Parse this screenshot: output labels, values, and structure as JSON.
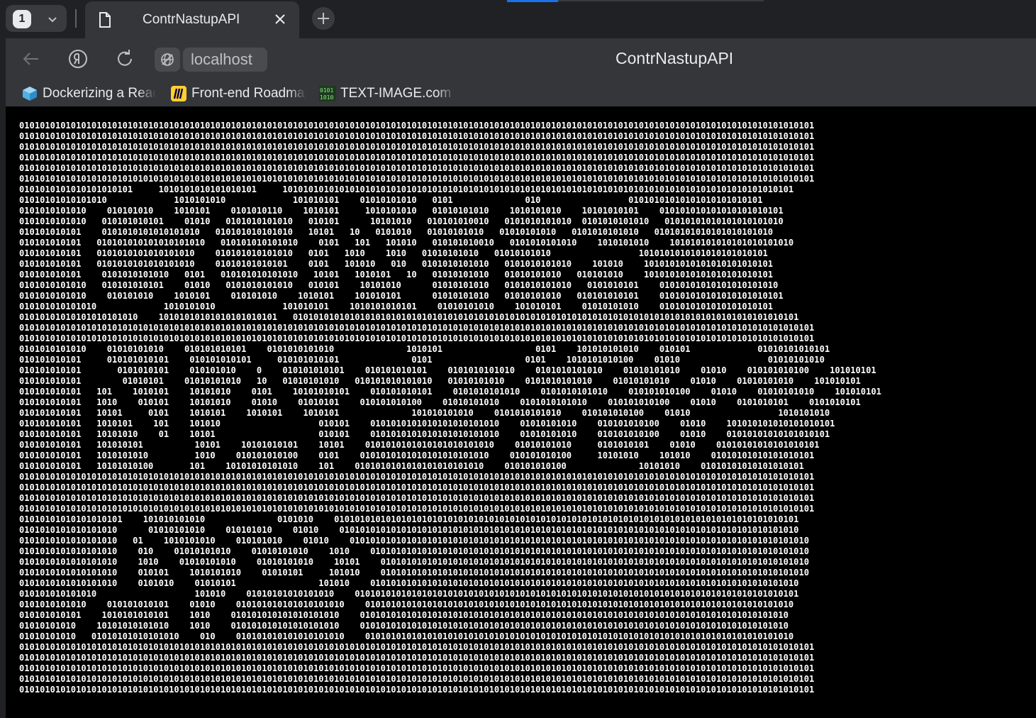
{
  "tabs": {
    "count": "1",
    "active_title": "ContrNastupAPI"
  },
  "toolbar": {
    "address": "localhost",
    "page_title": "ContrNastupAPI"
  },
  "bookmarks": [
    {
      "label": "Dockerizing a React",
      "icon": "cube-icon"
    },
    {
      "label": "Front-end Roadmap",
      "icon": "miro-logo-icon"
    },
    {
      "label": "TEXT-IMAGE.com :",
      "icon": "binary-icon"
    }
  ],
  "content": {
    "ascii_art": "0101010101010101010101010101010101010101010101010101010101010101010101010101010101010101010101010101010101010101010101010101010101010101010101010101010101\n0101010101010101010101010101010101010101010101010101010101010101010101010101010101010101010101010101010101010101010101010101010101010101010101010101010101\n0101010101010101010101010101010101010101010101010101010101010101010101010101010101010101010101010101010101010101010101010101010101010101010101010101010101\n0101010101010101010101010101010101010101010101010101010101010101010101010101010101010101010101010101010101010101010101010101010101010101010101010101010101\n0101010101010101010101010101010101010101010101010101010101010101010101010101010101010101010101010101010101010101010101010101010101010101010101010101010101\n0101010101010101010101010101010101010101010101010101010101010101010101010101010101010101010101010101010101010101010101010101010101010101010101010101010101\n0101010101010101010101     1010101010101010101     101010101010101010101010101010101010101010101010101010101010101010101010101010101010101010101010101\n01010101010101010             1010101010             101010101    01010101010   0101              010                 01010101010101010101010101\n0101010101010    010101010    1010101    0101010110    1010101     1010101010   01010101010    1010101010    10101010101    010101010101010101010101\n0101010101010   010101010101    01010   0101010101010   010101      10101010   010101010010   0101010101010  0101010101010   01010101010101010101010\n010101010101    0101010101010101010   010101010101010   10101   10   0101010   01010101010   01010101010   0101010101010   01010101010101010101010\n010101010101   010101010101010101010   010101010101010    0101   101   101010   010101010010   0101010101010    1010101010    101010101010101010101010\n010101010101   0101010101010101010    010101010101010   0101   1010    1010   01010101010   01010101010                 1010101010101010101010101\n010101010101   0101010101010101010    01010101010101    0101   101010   010   0101010101010   0101010101010    101010    1010101010101010101010101\n010101010101    0101010101010   0101   010101010101010   10101   1010101   10   01010101010   01010101010   010101010    1010101010101010101010101\n0101010101010   010101010101    01010   0101010101010   010101    10101010      01010101010   0101010101010   0101010101    01010101010101010101010\n0101010101010    010101010    1010101    010101010    1010101    101010101      01010101010   01010101010   010101010101    010101010101010101010101\n010101010101010             1010101010             101010101    1010101010101    01010101010    101010101    01010101010    0101010101010101010101\n01010101010101010101010    10101010101010101010101   01010101010101010101010101010101010101010101010101010101010101010101010101010101010101010101010101\n0101010101010101010101010101010101010101010101010101010101010101010101010101010101010101010101010101010101010101010101010101010101010101010101010101010101\n0101010101010101010101010101010101010101010101010101010101010101010101010101010101010101010101010101010101010101010101010101010101010101010101010101010101\n0101010101010    01010101010    010101010101    0101010101010              1010101                  0101    101010101010    010101             01010101010101\n010101010101     010101010101    010101010101     010101010101              0101                  0101    1010101010100    01010                 01010101010\n010101010101       0101010101    010101010    0    010101010101    010101010101    0101010101010    0101010101010    01010101010    01010    010101010100    101010101\n010101010101        01010101    01010101010   10   01010101010   010101010101010   01010101010    0101010101010    01010101010    01010    01010101010    101010101\n010101010101   101    1010101    10101010    0101    10101010101    010101010101    0101010101010    0101010101010    010101010100    01010    01010101010    101010101\n010101010101   1010    010101    10101010    01010    01010101    010101010100    01010101010    0101010101010    010101010100    01010    0101010101    0101010101\n010101010101   10101     0101    1010101    1010101    1010101              101010101010    0101010101010    010101010100    01010                 1010101010\n010101010101   1010101    101    101010                   010101    0101010101010101010101010    01010101010    010101010100    01010    101010101010101010101\n010101010101   10101010    01    10101                    010101    0101010101010101010101010    01010101010    010101010100    01010    01010101010101010101\n010101010101   101010101          10101    10101010101    10101    0101010101010101010101010    01010101010     0101010101    01010    01010101010101010101\n010101010101   1010101010         1010    010101010100    0101    0101010101010101010101010    010101010100     10101010    101010    01010101010101010101\n010101010101   10101010100       101    10101010101010    101    0101010101010101010101010    010101010100              10101010    01010101010101010101\n0101010101010101010101010101010101010101010101010101010101010101010101010101010101010101010101010101010101010101010101010101010101010101010101010101010101\n0101010101010101010101010101010101010101010101010101010101010101010101010101010101010101010101010101010101010101010101010101010101010101010101010101010101\n0101010101010101010101010101010101010101010101010101010101010101010101010101010101010101010101010101010101010101010101010101010101010101010101010101010101\n0101010101010101010101010101010101010101010101010101010101010101010101010101010101010101010101010101010101010101010101010101010101010101010101010101010101\n01010101010101010101    101010101010              0101010    010101010101010101010101010101010101010101010101010101010101010101010101010101010101010101\n0101010101010101010      01010101010    010101010    01010    01010101010101010101010101010101010101010101010101010101010101010101010101010101010101010\n0101010101010101010   01    1010101010    010101010    01010    01010101010101010101010101010101010101010101010101010101010101010101010101010101010101010\n0101010101010101010    010    01010101010    01010101010    1010    0101010101010101010101010101010101010101010101010101010101010101010101010101010101010\n0101010101010101010    1010    01010101010    01010101010    10101    01010101010101010101010101010101010101010101010101010101010101010101010101010101010\n0101010101010101010    010101    1010101010    01010101     101010    01010101010101010101010101010101010101010101010101010101010101010101010101010101010\n0101010101010101010    0101010    01010101                101010    01010101010101010101010101010101010101010101010101010101010101010101010101010101010\n010101010101010                   101010    01010101010101010    01010101010101010101010101010101010101010101010101010101010101010101010101010101010101\n0101010101010    010101010101    01010    010101010101010101010    01010101010101010101010101010101010101010101010101010101010101010101010101010101010\n010101010101    1010101010101    1010    010101010101010101010    01010101010101010101010101010101010101010101010101010101010101010101010101010101010\n01010101010    10101010101010    1010    010101010101010101010    01010101010101010101010101010101010101010101010101010101010101010101010101010101010\n01010101010   01010101010101010    010    010101010101010101010    01010101010101010101010101010101010101010101010101010101010101010101010101010101010\n0101010101010101010101010101010101010101010101010101010101010101010101010101010101010101010101010101010101010101010101010101010101010101010101010101010101\n0101010101010101010101010101010101010101010101010101010101010101010101010101010101010101010101010101010101010101010101010101010101010101010101010101010101\n0101010101010101010101010101010101010101010101010101010101010101010101010101010101010101010101010101010101010101010101010101010101010101010101010101010101\n0101010101010101010101010101010101010101010101010101010101010101010101010101010101010101010101010101010101010101010101010101010101010101010101010101010101\n0101010101010101010101010101010101010101010101010101010101010101010101010101010101010101010101010101010101010101010101010101010101010101010101010101010101"
  },
  "colors": {
    "tabstrip_bg": "#202124",
    "toolbar_bg": "#35363a",
    "page_bg": "#000000",
    "text": "#ffffff",
    "accent": "#1a73e8"
  }
}
